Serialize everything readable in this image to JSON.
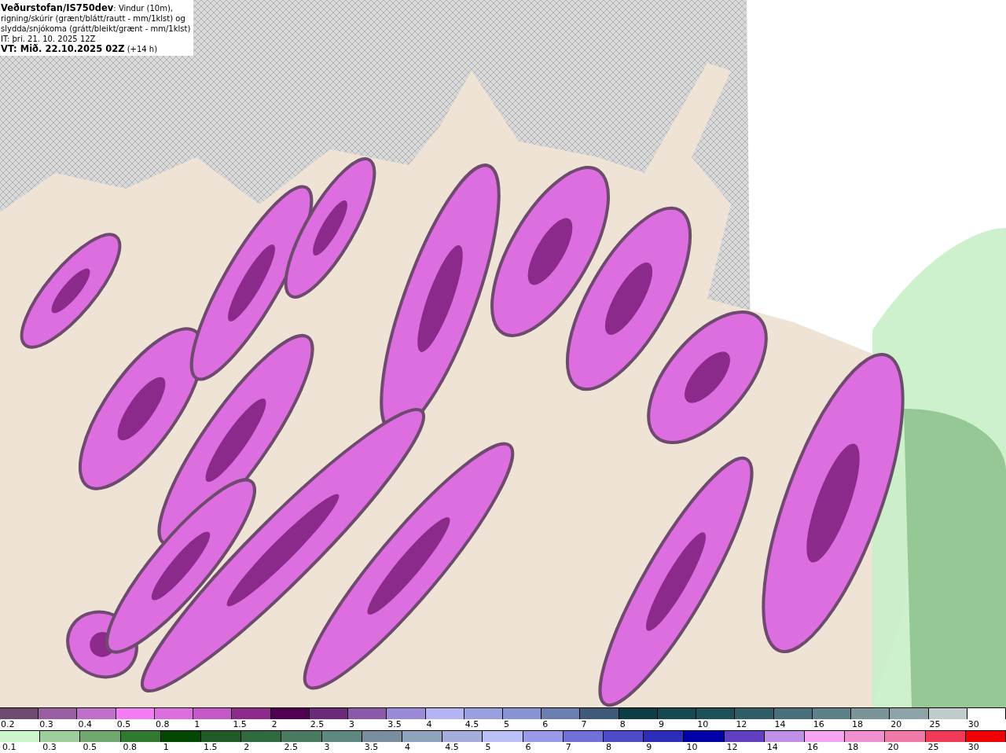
{
  "header": {
    "source": "Veðurstofan/IS750dev",
    "description": ": Vindur (10m),",
    "lines": [
      "rigning/skúrir (grænt/blátt/rautt - mm/1klst) og",
      "slydda/snjókoma (grátt/bleikt/grænt - mm/1klst)",
      "IT: þri. 21. 10. 2025 12Z"
    ],
    "valid_time": "VT: Mið. 22.10.2025 02Z",
    "lead": "(+14 h)"
  },
  "legends": [
    {
      "kind": "snow",
      "items": [
        {
          "label": "0.2",
          "color": "#6e4a6e"
        },
        {
          "label": "0.3",
          "color": "#9a5fa0"
        },
        {
          "label": "0.4",
          "color": "#c070c8"
        },
        {
          "label": "0.5",
          "color": "#f47cf4"
        },
        {
          "label": "0.8",
          "color": "#dd6ee0"
        },
        {
          "label": "1",
          "color": "#c458c8"
        },
        {
          "label": "1.5",
          "color": "#8c2a8c"
        },
        {
          "label": "2",
          "color": "#500050"
        },
        {
          "label": "2.5",
          "color": "#6a2a78"
        },
        {
          "label": "3",
          "color": "#8a5aa8"
        },
        {
          "label": "3.5",
          "color": "#9a8ad8"
        },
        {
          "label": "4",
          "color": "#b4b4f4"
        },
        {
          "label": "4.5",
          "color": "#98a0e0"
        },
        {
          "label": "5",
          "color": "#8a94d4"
        },
        {
          "label": "6",
          "color": "#6a7eb0"
        },
        {
          "label": "7",
          "color": "#3e5a78"
        },
        {
          "label": "8",
          "color": "#0c3c44"
        },
        {
          "label": "9",
          "color": "#164850"
        },
        {
          "label": "10",
          "color": "#1e5058"
        },
        {
          "label": "12",
          "color": "#2e5e64"
        },
        {
          "label": "14",
          "color": "#48707a"
        },
        {
          "label": "16",
          "color": "#5e8088"
        },
        {
          "label": "18",
          "color": "#7a9498"
        },
        {
          "label": "20",
          "color": "#8ea4a8"
        },
        {
          "label": "25",
          "color": "#c0cccc"
        },
        {
          "label": "30",
          "color": "#ffffff"
        }
      ]
    },
    {
      "kind": "rain",
      "items": [
        {
          "label": "0.1",
          "color": "#ccf5cc"
        },
        {
          "label": "0.3",
          "color": "#9ccf9c"
        },
        {
          "label": "0.5",
          "color": "#70a870"
        },
        {
          "label": "0.8",
          "color": "#307a30"
        },
        {
          "label": "1",
          "color": "#004800"
        },
        {
          "label": "1.5",
          "color": "#205a28"
        },
        {
          "label": "2",
          "color": "#306a40"
        },
        {
          "label": "2.5",
          "color": "#4a7a60"
        },
        {
          "label": "3",
          "color": "#5e8880"
        },
        {
          "label": "3.5",
          "color": "#7a8ea0"
        },
        {
          "label": "4",
          "color": "#8ea4bc"
        },
        {
          "label": "4.5",
          "color": "#a4acdc"
        },
        {
          "label": "5",
          "color": "#bcc0f8"
        },
        {
          "label": "6",
          "color": "#9a9ae8"
        },
        {
          "label": "7",
          "color": "#7070d8"
        },
        {
          "label": "8",
          "color": "#4c4cc8"
        },
        {
          "label": "9",
          "color": "#2c2cb8"
        },
        {
          "label": "10",
          "color": "#0000a8"
        },
        {
          "label": "12",
          "color": "#6040c0"
        },
        {
          "label": "14",
          "color": "#c090e8"
        },
        {
          "label": "16",
          "color": "#f4a4f0"
        },
        {
          "label": "18",
          "color": "#f090d0"
        },
        {
          "label": "20",
          "color": "#f07aa8"
        },
        {
          "label": "25",
          "color": "#f03a58"
        },
        {
          "label": "30",
          "color": "#f00000"
        }
      ]
    }
  ]
}
